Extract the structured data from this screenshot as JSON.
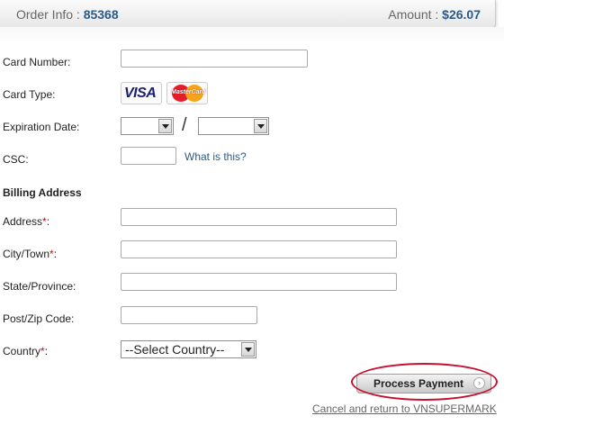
{
  "header": {
    "order_label": "Order Info : ",
    "order_number": "85368",
    "amount_label": "Amount : ",
    "amount_value": "$26.07"
  },
  "form": {
    "card_number_label": "Card Number:",
    "card_type_label": "Card Type:",
    "card_types": [
      "VISA",
      "MasterCard"
    ],
    "expiration_label": "Expiration Date:",
    "expiration_month_value": "",
    "expiration_year_value": "",
    "csc_label": "CSC:",
    "csc_help_link": "What is this?",
    "billing_title": "Billing Address",
    "address_label": "Address",
    "city_label": "City/Town",
    "state_label": "State/Province:",
    "zip_label": "Post/Zip Code:",
    "country_label": "Country",
    "country_selected": "--Select Country--",
    "required_marker": "*",
    "colon": ":"
  },
  "actions": {
    "process_label": "Process Payment",
    "cancel_link": "Cancel and return to VNSUPERMARK"
  },
  "colors": {
    "accent_blue": "#2a5b87",
    "required_red": "#dd0000",
    "highlight_ellipse": "#c8102e"
  }
}
